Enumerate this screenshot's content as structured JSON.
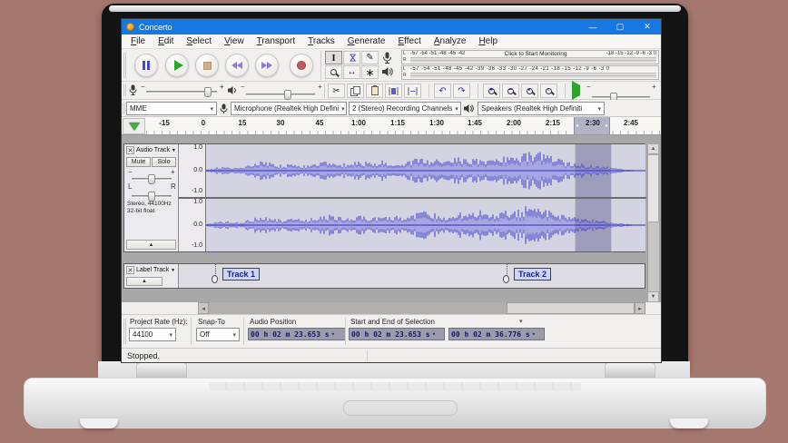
{
  "window": {
    "title": "Concerto",
    "minimize": "—",
    "maximize": "▢",
    "close": "✕"
  },
  "menu": [
    "File",
    "Edit",
    "Select",
    "View",
    "Transport",
    "Tracks",
    "Generate",
    "Effect",
    "Analyze",
    "Help"
  ],
  "icons": {
    "selection_tool": "I",
    "envelope_tool": "⋈",
    "draw_tool": "✎",
    "timeshift_tool": "↔",
    "multi_tool": "∗",
    "undo": "↶",
    "redo": "↷",
    "cut": "✂",
    "dropdown": "▾",
    "track_dropdown": "▼",
    "collapse": "▲",
    "scroll_up": "▲",
    "scroll_down": "▼",
    "scroll_left": "◂",
    "scroll_right": "▸",
    "close": "✕",
    "sel_left": "◂",
    "sel_right": "▸"
  },
  "meters": {
    "record": {
      "l": "L",
      "r": "R",
      "scale_left": "-57 -54 -51 -48 -45 -42",
      "monitor": "Click to Start Monitoring",
      "scale_right": "-18 -15 -12 -9 -6 -3 0"
    },
    "play": {
      "l": "L",
      "r": "R",
      "scale": "-57 -54 -51 -48 -45 -42 -39 -36 -33 -30 -27 -24 -21 -18 -15 -12 -9 -6 -3 0"
    }
  },
  "mixer": {
    "min": "−",
    "max": "+"
  },
  "speed": {
    "min": "−",
    "max": "+"
  },
  "device": {
    "host": "MME",
    "input": "Microphone (Realtek High Defini",
    "channels": "2 (Stereo) Recording Channels",
    "output": "Speakers (Realtek High Definiti"
  },
  "timeline": {
    "ticks": [
      "-15",
      "0",
      "15",
      "30",
      "45",
      "1:00",
      "1:15",
      "1:30",
      "1:45",
      "2:00",
      "2:15",
      "2:30",
      "2:45"
    ]
  },
  "track": {
    "name": "Audio Track",
    "mute": "Mute",
    "solo": "Solo",
    "gain_min": "−",
    "gain_max": "+",
    "pan_min": "L",
    "pan_max": "R",
    "info1": "Stereo, 44100Hz",
    "info2": "32-bit float",
    "scale_top": "1.0",
    "scale_mid": "0.0",
    "scale_bot": "-1.0"
  },
  "label_track": {
    "name": "Label Track",
    "labels": [
      "Track 1",
      "Track 2"
    ]
  },
  "selection_bar": {
    "rate_label": "Project Rate (Hz):",
    "rate_value": "44100",
    "snap_label": "Snap-To",
    "snap_value": "Off",
    "position_label": "Audio Position",
    "position_value": "00 h 02 m 23.653 s",
    "range_label": "Start and End of Selection",
    "range_start": "00 h 02 m 23.653 s",
    "range_end": "00 h 02 m 36.776 s"
  },
  "status": {
    "text": "Stopped."
  },
  "waveform": {
    "selection_start": 0.84,
    "selection_end": 0.922,
    "envelope": [
      0.04,
      0.12,
      0.16,
      0.1,
      0.22,
      0.35,
      0.28,
      0.22,
      0.26,
      0.2,
      0.3,
      0.4,
      0.32,
      0.26,
      0.36,
      0.3,
      0.42,
      0.36,
      0.3,
      0.44,
      0.52,
      0.44,
      0.38,
      0.5,
      0.42,
      0.54,
      0.46,
      0.6,
      0.52,
      0.68,
      0.82,
      0.64,
      0.46,
      0.32,
      0.26,
      0.22,
      0.18,
      0.12,
      0.06,
      0.02,
      0.01
    ]
  },
  "colors": {
    "titlebar": "#1679e3",
    "wave": "#3b3bcd",
    "wave_rms": "#7a7ae2",
    "wave_bg": "#d3d3e1",
    "wave_selection": "#9d9dbb"
  }
}
